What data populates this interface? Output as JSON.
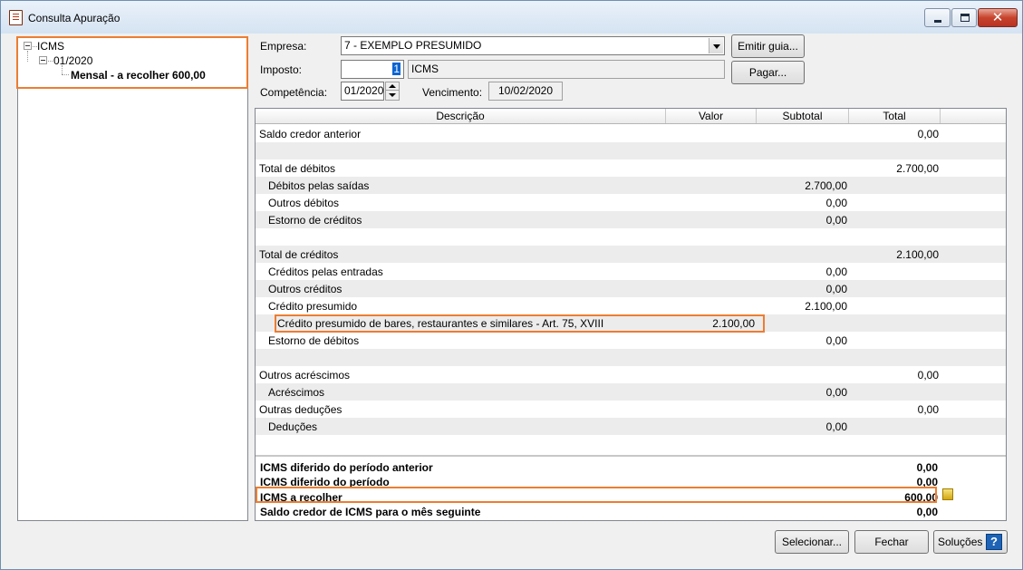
{
  "window": {
    "title": "Consulta Apuração"
  },
  "tree": {
    "root": "ICMS",
    "period": "01/2020",
    "leaf": "Mensal - a recolher 600,00"
  },
  "form": {
    "empresa_label": "Empresa:",
    "empresa_value": "7 - EXEMPLO PRESUMIDO",
    "imposto_label": "Imposto:",
    "imposto_code": "1",
    "imposto_name": "ICMS",
    "competencia_label": "Competência:",
    "competencia_value": "01/2020",
    "vencimento_label": "Vencimento:",
    "vencimento_value": "10/02/2020"
  },
  "buttons": {
    "emitir_guia": "Emitir guia...",
    "pagar": "Pagar...",
    "selecionar": "Selecionar...",
    "fechar": "Fechar",
    "solucoes": "Soluções"
  },
  "grid": {
    "columns": [
      "Descrição",
      "Valor",
      "Subtotal",
      "Total"
    ],
    "rows": [
      {
        "desc": "Saldo credor anterior",
        "indent": 0,
        "valor": "",
        "subtotal": "",
        "total": "0,00"
      },
      {
        "desc": "",
        "indent": 0,
        "valor": "",
        "subtotal": "",
        "total": ""
      },
      {
        "desc": "Total de débitos",
        "indent": 0,
        "valor": "",
        "subtotal": "",
        "total": "2.700,00"
      },
      {
        "desc": "Débitos pelas saídas",
        "indent": 1,
        "valor": "",
        "subtotal": "2.700,00",
        "total": ""
      },
      {
        "desc": "Outros débitos",
        "indent": 1,
        "valor": "",
        "subtotal": "0,00",
        "total": ""
      },
      {
        "desc": "Estorno de créditos",
        "indent": 1,
        "valor": "",
        "subtotal": "0,00",
        "total": ""
      },
      {
        "desc": "",
        "indent": 0,
        "valor": "",
        "subtotal": "",
        "total": ""
      },
      {
        "desc": "Total de créditos",
        "indent": 0,
        "valor": "",
        "subtotal": "",
        "total": "2.100,00"
      },
      {
        "desc": "Créditos pelas entradas",
        "indent": 1,
        "valor": "",
        "subtotal": "0,00",
        "total": ""
      },
      {
        "desc": "Outros créditos",
        "indent": 1,
        "valor": "",
        "subtotal": "0,00",
        "total": ""
      },
      {
        "desc": "Crédito presumido",
        "indent": 1,
        "valor": "",
        "subtotal": "2.100,00",
        "total": ""
      },
      {
        "desc": "Crédito presumido de bares, restaurantes e similares - Art. 75, XVIII",
        "indent": 2,
        "valor": "2.100,00",
        "subtotal": "",
        "total": ""
      },
      {
        "desc": "Estorno de débitos",
        "indent": 1,
        "valor": "",
        "subtotal": "0,00",
        "total": ""
      },
      {
        "desc": "",
        "indent": 0,
        "valor": "",
        "subtotal": "",
        "total": ""
      },
      {
        "desc": "Outros acréscimos",
        "indent": 0,
        "valor": "",
        "subtotal": "",
        "total": "0,00"
      },
      {
        "desc": "Acréscimos",
        "indent": 1,
        "valor": "",
        "subtotal": "0,00",
        "total": ""
      },
      {
        "desc": "Outras deduções",
        "indent": 0,
        "valor": "",
        "subtotal": "",
        "total": "0,00"
      },
      {
        "desc": "Deduções",
        "indent": 1,
        "valor": "",
        "subtotal": "0,00",
        "total": ""
      }
    ]
  },
  "summary": [
    {
      "desc": "ICMS diferido do período anterior",
      "value": "0,00"
    },
    {
      "desc": "ICMS diferido do período",
      "value": "0,00"
    },
    {
      "desc": "ICMS a recolher",
      "value": "600,00"
    },
    {
      "desc": "Saldo credor de ICMS para o mês seguinte",
      "value": "0,00"
    }
  ],
  "colors": {
    "highlight": "#ed7d31",
    "selection": "#0a64d2"
  }
}
